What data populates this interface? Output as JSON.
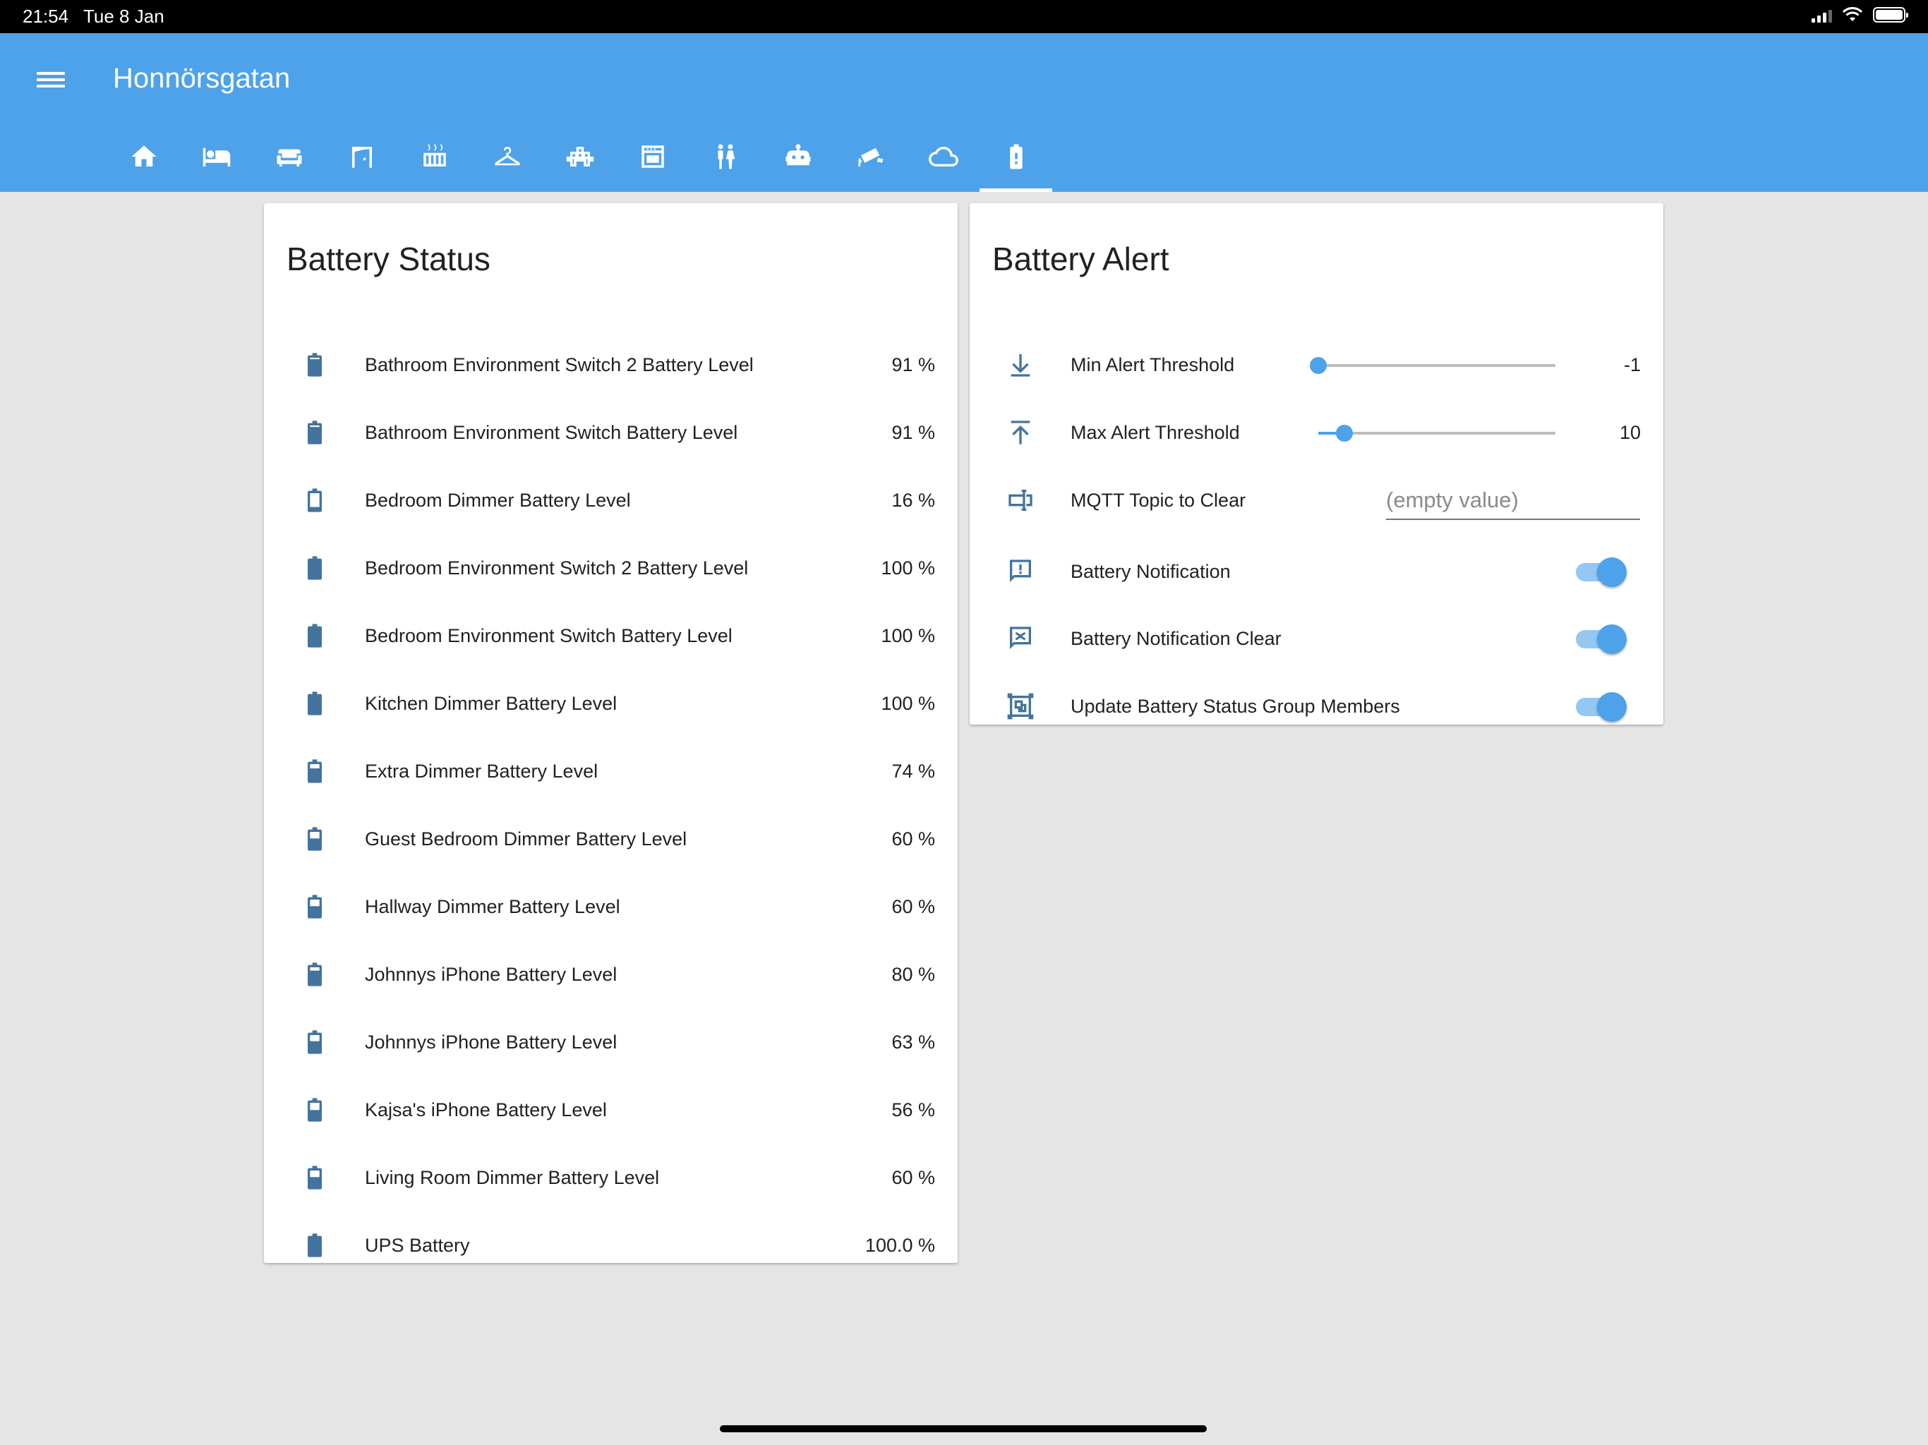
{
  "status_bar": {
    "time": "21:54",
    "date": "Tue 8 Jan"
  },
  "header": {
    "title": "Honnörsgatan"
  },
  "tabs": [
    {
      "icon": "home-icon"
    },
    {
      "icon": "bed-icon"
    },
    {
      "icon": "sofa-icon"
    },
    {
      "icon": "door-icon"
    },
    {
      "icon": "radiator-icon"
    },
    {
      "icon": "hanger-icon"
    },
    {
      "icon": "blocks-icon"
    },
    {
      "icon": "oven-icon"
    },
    {
      "icon": "people-icon"
    },
    {
      "icon": "robot-icon"
    },
    {
      "icon": "security-camera-icon"
    },
    {
      "icon": "cloud-icon"
    },
    {
      "icon": "battery-alert-icon",
      "active": true
    }
  ],
  "battery_status": {
    "title": "Battery Status",
    "items": [
      {
        "label": "Bathroom Environment Switch 2 Battery Level",
        "value": "91 %",
        "level": 0.91
      },
      {
        "label": "Bathroom Environment Switch Battery Level",
        "value": "91 %",
        "level": 0.91
      },
      {
        "label": "Bedroom Dimmer Battery Level",
        "value": "16 %",
        "level": 0.16
      },
      {
        "label": "Bedroom Environment Switch 2 Battery Level",
        "value": "100 %",
        "level": 1.0
      },
      {
        "label": "Bedroom Environment Switch Battery Level",
        "value": "100 %",
        "level": 1.0
      },
      {
        "label": "Kitchen Dimmer Battery Level",
        "value": "100 %",
        "level": 1.0
      },
      {
        "label": "Extra Dimmer Battery Level",
        "value": "74 %",
        "level": 0.74
      },
      {
        "label": "Guest Bedroom Dimmer Battery Level",
        "value": "60 %",
        "level": 0.6
      },
      {
        "label": "Hallway Dimmer Battery Level",
        "value": "60 %",
        "level": 0.6
      },
      {
        "label": "Johnnys iPhone Battery Level",
        "value": "80 %",
        "level": 0.8
      },
      {
        "label": "Johnnys iPhone Battery Level",
        "value": "63 %",
        "level": 0.63
      },
      {
        "label": "Kajsa's iPhone Battery Level",
        "value": "56 %",
        "level": 0.56
      },
      {
        "label": "Living Room Dimmer Battery Level",
        "value": "60 %",
        "level": 0.6
      },
      {
        "label": "UPS Battery",
        "value": "100.0 %",
        "level": 1.0
      }
    ]
  },
  "battery_alert": {
    "title": "Battery Alert",
    "min_threshold": {
      "label": "Min Alert Threshold",
      "value": "-1",
      "slider_fraction": 0.0
    },
    "max_threshold": {
      "label": "Max Alert Threshold",
      "value": "10",
      "slider_fraction": 0.11
    },
    "mqtt_topic": {
      "label": "MQTT Topic to Clear",
      "placeholder": "(empty value)",
      "value": ""
    },
    "notification": {
      "label": "Battery Notification",
      "on": true
    },
    "notification_clear": {
      "label": "Battery Notification Clear",
      "on": true
    },
    "update_group": {
      "label": "Update Battery Status Group Members",
      "on": true
    }
  },
  "colors": {
    "header": "#4da2ea",
    "icon": "#44739e",
    "accent": "#4da2ea",
    "background": "#e5e5e5"
  }
}
